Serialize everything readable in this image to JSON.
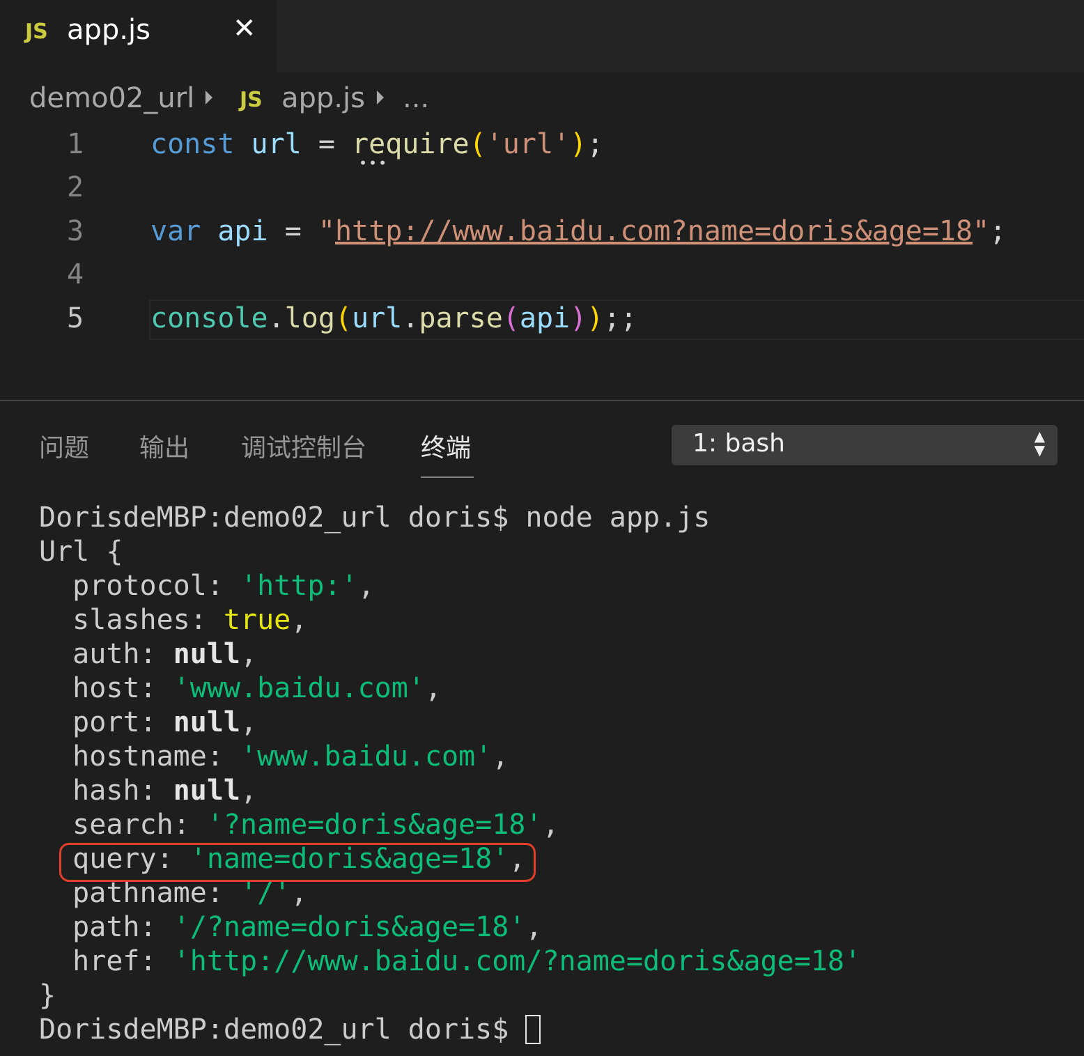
{
  "tab": {
    "badge": "JS",
    "label": "app.js",
    "close": "✕"
  },
  "breadcrumb": {
    "folder": "demo02_url",
    "sep": "⏵",
    "file_badge": "JS",
    "file": "app.js",
    "more": "..."
  },
  "editor": {
    "line_numbers": [
      "1",
      "2",
      "3",
      "4",
      "5"
    ],
    "line1": {
      "const": "const",
      "url": "url",
      "eq": "=",
      "require": "require",
      "p1": "(",
      "arg": "'url'",
      "p2": ")",
      "semi": ";"
    },
    "line3": {
      "var": "var",
      "api": "api",
      "eq": "=",
      "q1": "\"",
      "url": "http://www.baidu.com?name=doris&age=18",
      "q2": "\"",
      "semi": ";"
    },
    "line5": {
      "console": "console",
      "dot1": ".",
      "log": "log",
      "p1": "(",
      "url": "url",
      "dot2": ".",
      "parse": "parse",
      "p2": "(",
      "api": "api",
      "p3": ")",
      "p4": ")",
      "semi": ";;"
    },
    "dots": "•••"
  },
  "panel": {
    "tabs": [
      "问题",
      "输出",
      "调试控制台",
      "终端"
    ],
    "terminal_select": "1: bash",
    "select_arrows": "▲▼"
  },
  "terminal": {
    "prompt_cmd": "DorisdeMBP:demo02_url doris$ node app.js",
    "open": "Url {",
    "fields": [
      {
        "key": "  protocol: ",
        "value": "'http:'",
        "tail": ",",
        "kind": "str"
      },
      {
        "key": "  slashes: ",
        "value": "true",
        "tail": ",",
        "kind": "bool"
      },
      {
        "key": "  auth: ",
        "value": "null",
        "tail": ",",
        "kind": "null"
      },
      {
        "key": "  host: ",
        "value": "'www.baidu.com'",
        "tail": ",",
        "kind": "str"
      },
      {
        "key": "  port: ",
        "value": "null",
        "tail": ",",
        "kind": "null"
      },
      {
        "key": "  hostname: ",
        "value": "'www.baidu.com'",
        "tail": ",",
        "kind": "str"
      },
      {
        "key": "  hash: ",
        "value": "null",
        "tail": ",",
        "kind": "null"
      },
      {
        "key": "  search: ",
        "value": "'?name=doris&age=18'",
        "tail": ",",
        "kind": "str"
      },
      {
        "key": "  query: ",
        "value": "'name=doris&age=18'",
        "tail": ",",
        "kind": "str"
      },
      {
        "key": "  pathname: ",
        "value": "'/'",
        "tail": ",",
        "kind": "str"
      },
      {
        "key": "  path: ",
        "value": "'/?name=doris&age=18'",
        "tail": ",",
        "kind": "str"
      },
      {
        "key": "  href: ",
        "value": "'http://www.baidu.com/?name=doris&age=18'",
        "tail": "",
        "kind": "str"
      }
    ],
    "close": "}",
    "prompt": "DorisdeMBP:demo02_url doris$ "
  },
  "colors": {
    "highlight_box": "#e0402a",
    "string_green": "#0dbc79",
    "js_badge": "#cbcb41"
  }
}
